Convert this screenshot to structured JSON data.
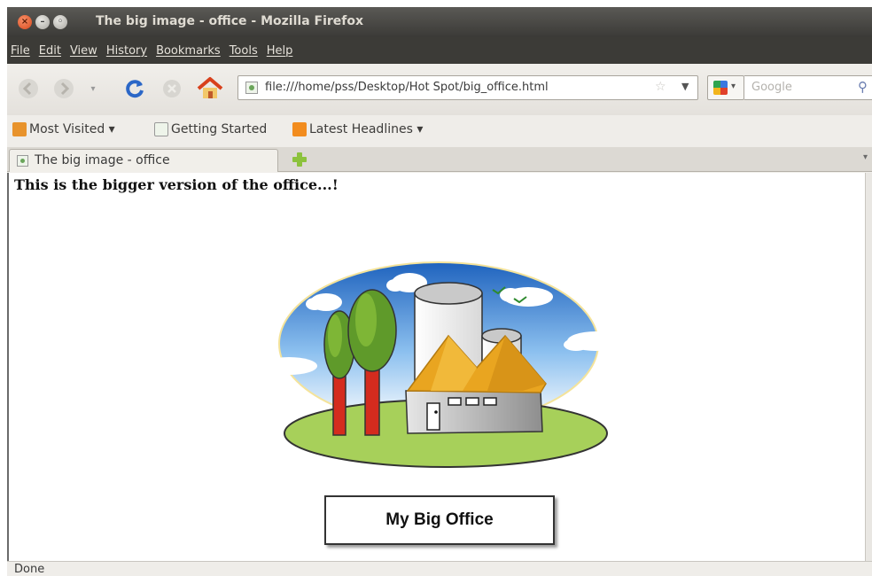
{
  "window": {
    "title": "The big image - office - Mozilla Firefox"
  },
  "menu": [
    "File",
    "Edit",
    "View",
    "History",
    "Bookmarks",
    "Tools",
    "Help"
  ],
  "toolbar": {
    "url": "file:///home/pss/Desktop/Hot Spot/big_office.html",
    "search_placeholder": "Google",
    "icons": [
      "back-icon",
      "forward-icon",
      "reload-icon",
      "stop-icon",
      "home-icon",
      "bookmark-star-icon",
      "search-engine-icon",
      "search-icon"
    ]
  },
  "bookmarks": {
    "most_visited": "Most Visited ▾",
    "getting_started": "Getting Started",
    "latest_headlines": "Latest Headlines ▾"
  },
  "tabs": [
    {
      "label": "The big image - office"
    }
  ],
  "page": {
    "heading": "This is the bigger version of the office...!",
    "caption": "My Big Office"
  },
  "status": "Done",
  "colors": {
    "titlebar": "#3b3a37",
    "menubar": "#3c3b37",
    "sky": "#2e78c8",
    "grass": "#a7d05a",
    "roof": "#e9a520",
    "trunk": "#d42b1e"
  }
}
